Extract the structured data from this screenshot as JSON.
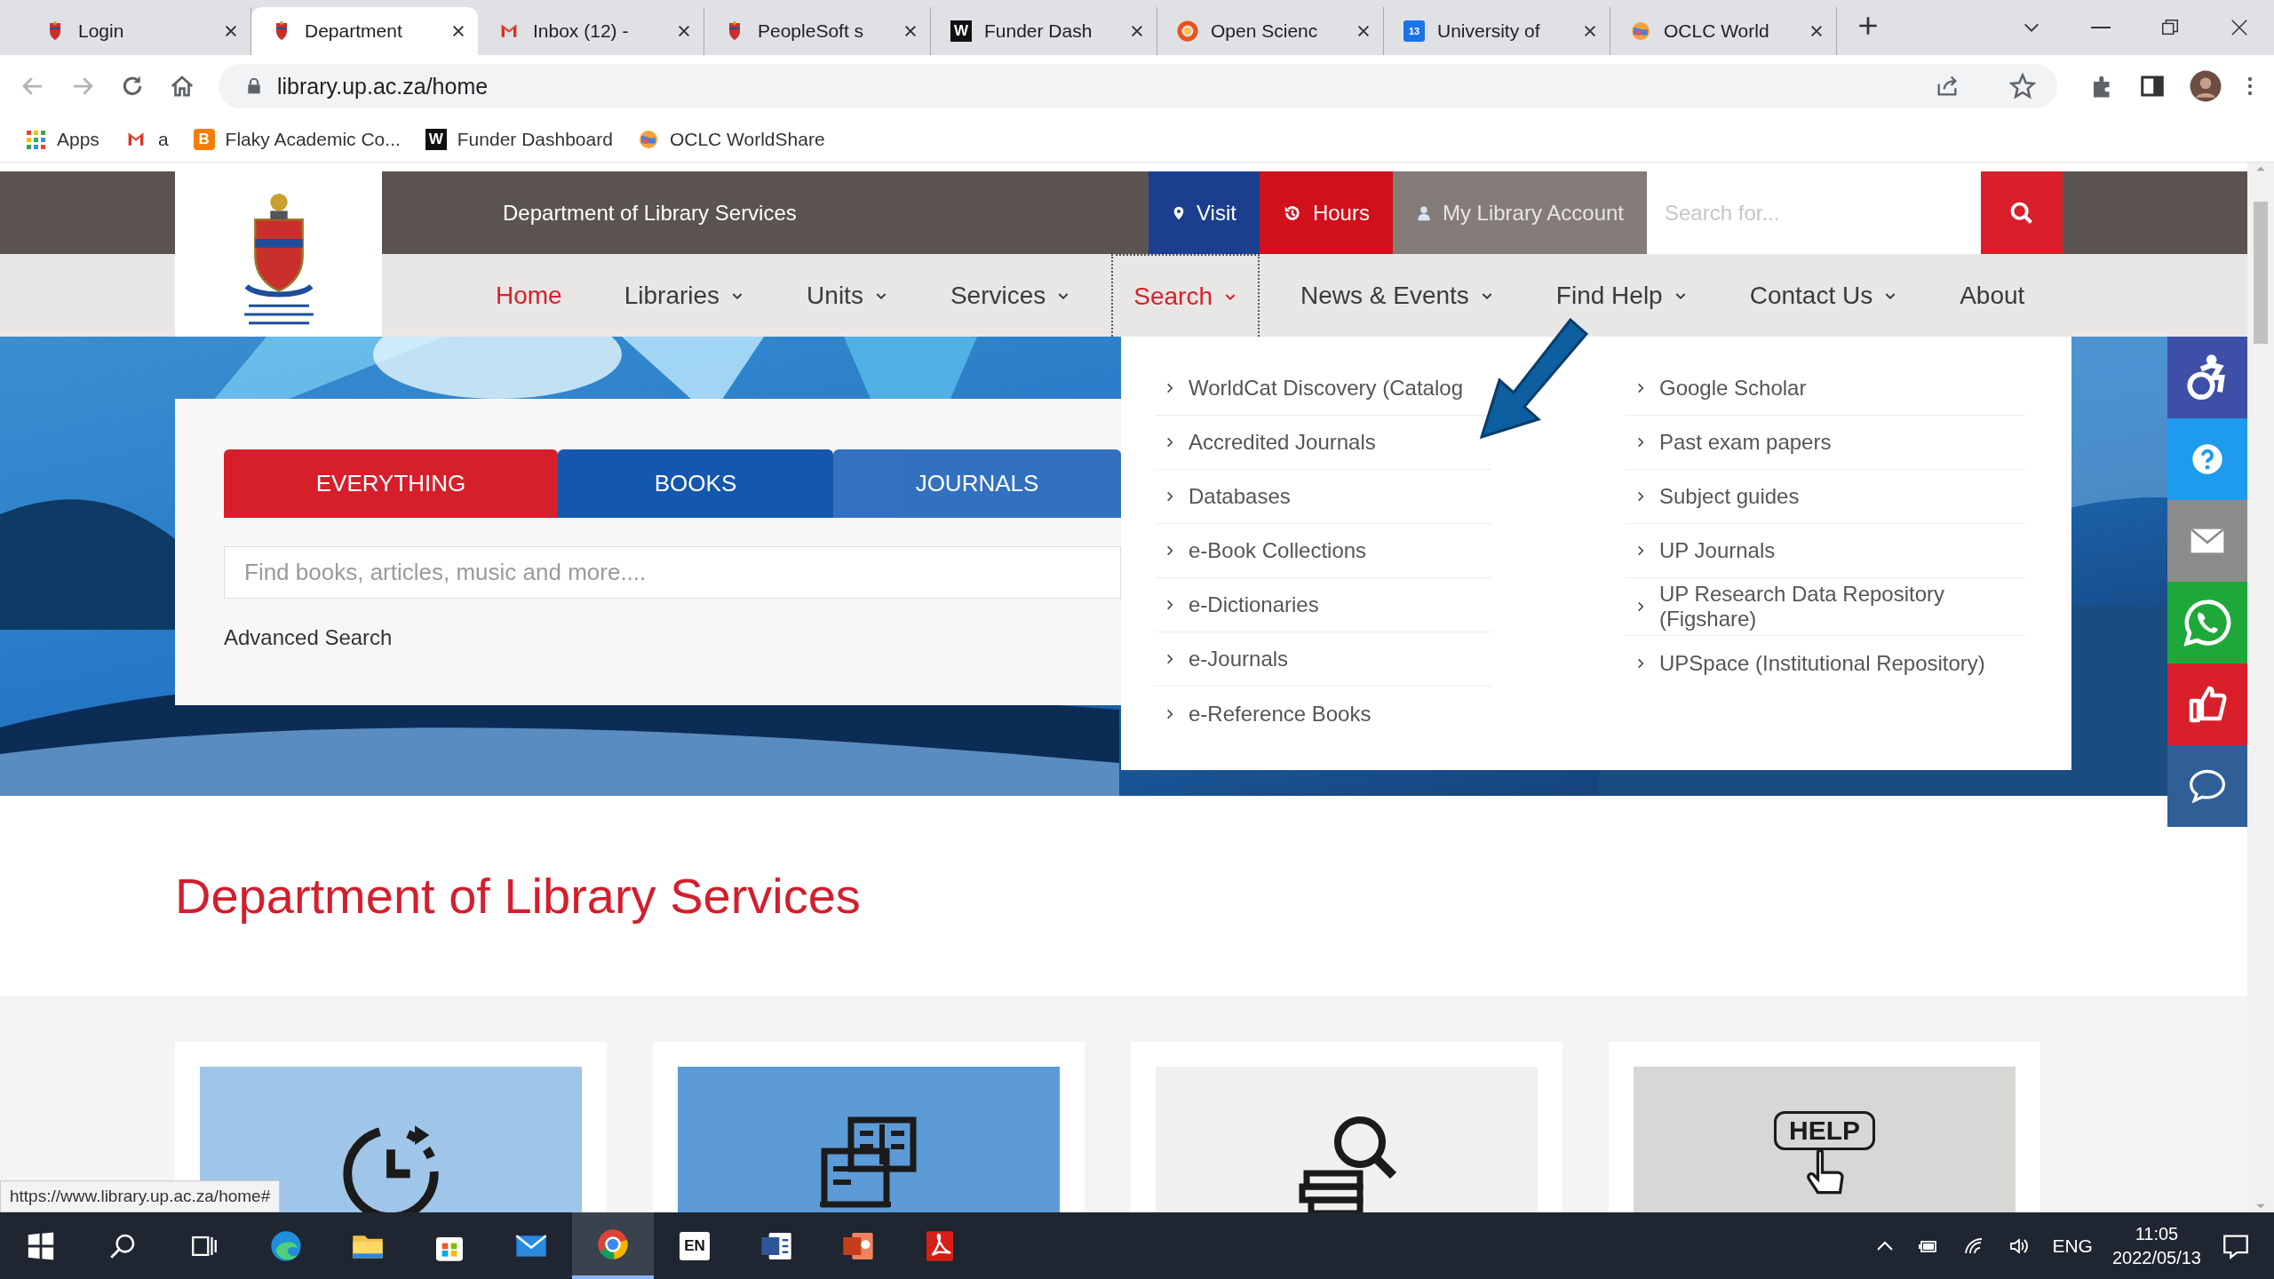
{
  "browser": {
    "tabs": [
      {
        "title": "Login",
        "kind": "crest",
        "selected": false
      },
      {
        "title": "Department",
        "kind": "crest",
        "selected": true
      },
      {
        "title": "Inbox (12) -",
        "kind": "mail",
        "selected": false
      },
      {
        "title": "PeopleSoft s",
        "kind": "crest",
        "selected": false
      },
      {
        "title": "Funder Dash",
        "kind": "letter",
        "glyph": "W",
        "selected": false
      },
      {
        "title": "Open Scienc",
        "kind": "ring",
        "selected": false
      },
      {
        "title": "University of",
        "kind": "calendar",
        "glyph": "13",
        "selected": false
      },
      {
        "title": "OCLC World",
        "kind": "globe",
        "selected": false
      }
    ],
    "address": "library.up.ac.za/home",
    "bookmarks": [
      {
        "label": "Apps",
        "kind": "grid"
      },
      {
        "label": "a",
        "kind": "mail"
      },
      {
        "label": "Flaky Academic Co...",
        "kind": "blog",
        "glyph": "B"
      },
      {
        "label": "Funder Dashboard",
        "kind": "letter",
        "glyph": "W"
      },
      {
        "label": "OCLC WorldShare",
        "kind": "globe"
      }
    ],
    "status_url": "https://www.library.up.ac.za/home#"
  },
  "header": {
    "title": "Department of Library Services",
    "visit": "Visit",
    "hours": "Hours",
    "account": "My Library Account",
    "search_placeholder": "Search for..."
  },
  "nav": [
    {
      "label": "Home",
      "kind": "link",
      "selected": true,
      "expanded": false
    },
    {
      "label": "Libraries",
      "kind": "menu",
      "selected": false,
      "expanded": false
    },
    {
      "label": "Units",
      "kind": "menu",
      "selected": false,
      "expanded": false
    },
    {
      "label": "Services",
      "kind": "menu",
      "selected": false,
      "expanded": false
    },
    {
      "label": "Search",
      "kind": "menu",
      "selected": true,
      "expanded": true
    },
    {
      "label": "News & Events",
      "kind": "menu",
      "selected": false,
      "expanded": false
    },
    {
      "label": "Find Help",
      "kind": "menu",
      "selected": false,
      "expanded": false
    },
    {
      "label": "Contact Us",
      "kind": "menu",
      "selected": false,
      "expanded": false
    },
    {
      "label": "About",
      "kind": "link",
      "selected": false,
      "expanded": false
    }
  ],
  "search_panel": {
    "tabs": [
      {
        "label": "EVERYTHING",
        "selected": true
      },
      {
        "label": "BOOKS",
        "selected": false,
        "color": "#0c52ad"
      },
      {
        "label": "JOURNALS",
        "selected": false,
        "color": "#2c6cbf"
      }
    ],
    "placeholder": "Find books, articles, music and more....",
    "advanced": "Advanced Search"
  },
  "dropdown": {
    "columns": [
      {
        "items": [
          "WorldCat Discovery (Catalog",
          "Accredited Journals",
          "Databases",
          "e-Book Collections",
          "e-Dictionaries",
          "e-Journals",
          "e-Reference Books"
        ]
      },
      {
        "items": [
          "Google Scholar",
          "Past exam papers",
          "Subject guides",
          "UP Journals",
          "UP Research Data Repository (Figshare)",
          "UPSpace (Institutional Repository)"
        ]
      }
    ]
  },
  "side_buttons": [
    {
      "kind": "accessibility",
      "color": "#3d4fa6"
    },
    {
      "kind": "help",
      "color": "#1e9bef"
    },
    {
      "kind": "mail",
      "color": "#8c8c8c"
    },
    {
      "kind": "whatsapp",
      "color": "#1fa83a"
    },
    {
      "kind": "like",
      "color": "#d91f2a"
    },
    {
      "kind": "chat",
      "color": "#2f5f96"
    }
  ],
  "heading": "Department of Library Services",
  "cards": [
    {
      "kind": "clock",
      "color": "#9fc5e8"
    },
    {
      "kind": "reader",
      "color": "#5d9bd6"
    },
    {
      "kind": "search-books",
      "color": "#f1f0ef"
    },
    {
      "kind": "help-sign",
      "color": "#d8d7d5",
      "label": "HELP"
    }
  ],
  "taskbar": {
    "apps": [
      {
        "kind": "start",
        "active": false
      },
      {
        "kind": "search",
        "active": false
      },
      {
        "kind": "taskview",
        "active": false
      },
      {
        "kind": "edge",
        "active": false
      },
      {
        "kind": "folder",
        "active": false
      },
      {
        "kind": "store",
        "active": false
      },
      {
        "kind": "mail",
        "active": false
      },
      {
        "kind": "chrome",
        "active": true
      },
      {
        "kind": "keyboard",
        "label": "EN",
        "active": false
      },
      {
        "kind": "word",
        "active": false
      },
      {
        "kind": "powerpoint",
        "active": false
      },
      {
        "kind": "acrobat",
        "active": false
      }
    ],
    "language": "ENG",
    "time": "11:05",
    "date": "2022/05/13"
  }
}
